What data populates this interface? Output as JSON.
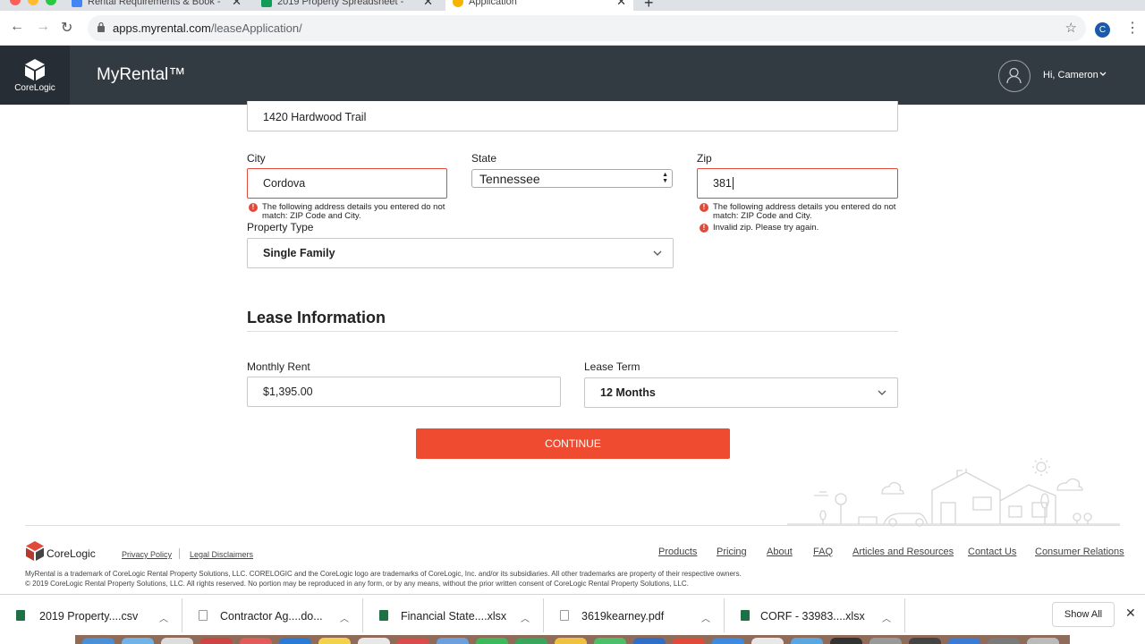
{
  "browser": {
    "tabs": [
      {
        "title": "Rental Requirements & Book - ",
        "active": false
      },
      {
        "title": "2019 Property Spreadsheet - ",
        "active": false
      },
      {
        "title": "Application",
        "active": true
      }
    ],
    "url_domain": "apps.myrental.com",
    "url_path": "/leaseApplication/",
    "profile_initial": "C"
  },
  "header": {
    "brand_label": "CoreLogic",
    "app_name": "MyRental™",
    "greeting": "Hi, Cameron"
  },
  "form": {
    "street_value": "1420 Hardwood Trail",
    "city": {
      "label": "City",
      "value": "Cordova",
      "error": "The following address details you entered do not match: ZIP Code and City."
    },
    "state": {
      "label": "State",
      "value": "Tennessee"
    },
    "zip": {
      "label": "Zip",
      "value": "381",
      "error1": "The following address details you entered do not match: ZIP Code and City.",
      "error2": "Invalid zip. Please try again."
    },
    "property_type": {
      "label": "Property Type",
      "value": "Single Family"
    }
  },
  "lease": {
    "section_title": "Lease Information",
    "monthly_rent": {
      "label": "Monthly Rent",
      "value": "$1,395.00"
    },
    "lease_term": {
      "label": "Lease Term",
      "value": "12 Months"
    },
    "continue_label": "CONTINUE"
  },
  "footer": {
    "logo_text": "CoreLogic",
    "privacy": "Privacy Policy",
    "legal": "Legal Disclaimers",
    "links": [
      "Products",
      "Pricing",
      "About",
      "FAQ",
      "Articles and Resources",
      "Contact Us",
      "Consumer Relations"
    ],
    "trademark": "MyRental is a trademark of CoreLogic Rental Property Solutions, LLC. CORELOGIC and the CoreLogic logo are trademarks of CoreLogic, Inc. and/or its subsidiaries. All other trademarks are property of their respective owners.",
    "copyright": "© 2019 CoreLogic Rental Property Solutions, LLC. All rights reserved. No portion may be reproduced in any form, or by any means, without the prior written consent of CoreLogic Rental Property Solutions, LLC."
  },
  "downloads": {
    "items": [
      {
        "name": "2019 Property....csv",
        "icon": "excel-icon"
      },
      {
        "name": "Contractor Ag....do...",
        "icon": "document-icon"
      },
      {
        "name": "Financial State....xlsx",
        "icon": "excel-icon"
      },
      {
        "name": "3619kearney.pdf",
        "icon": "pdf-icon"
      },
      {
        "name": "CORF - 33983....xlsx",
        "icon": "excel-icon"
      }
    ],
    "show_all": "Show All"
  },
  "colors": {
    "header_bg": "#323a42",
    "accent": "#ef4b31",
    "error": "#e04a3a"
  }
}
